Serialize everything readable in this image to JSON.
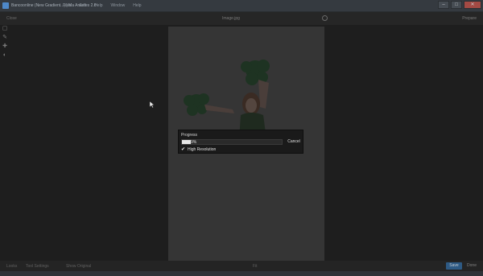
{
  "window": {
    "title": "Bancoonline (New Gradient...) | Ma Anastes 2.0",
    "menu": [
      "Files",
      "Edit",
      "Help",
      "Window",
      "Help"
    ],
    "controls": [
      "–",
      "□",
      "✕"
    ]
  },
  "topbar": {
    "left": "Close",
    "center": "Image.jpg",
    "right": "Prepare"
  },
  "bottombar": {
    "left": "Looks",
    "middle": "Tool Settings",
    "check": "Show Original",
    "zoom": "Fit",
    "share": "Save",
    "done": "Done"
  },
  "dialog": {
    "title": "Progress",
    "progress_text": "9%",
    "progress": 0.09,
    "cancel": "Cancel",
    "checkbox_label": "High Resolution",
    "checkbox_checked": true
  },
  "icons": {
    "tool_1": "crop-icon",
    "tool_2": "brush-icon",
    "tool_3": "heal-icon",
    "tool_4": "adjust-icon",
    "cursor": "mouse-pointer-icon",
    "check": "checkmark-icon"
  },
  "colors": {
    "overlay": "#1e1e1e",
    "dialog_bg": "#1a1a1a",
    "progress_fill": "#e6e6e6",
    "accent": "#2e5a84"
  }
}
